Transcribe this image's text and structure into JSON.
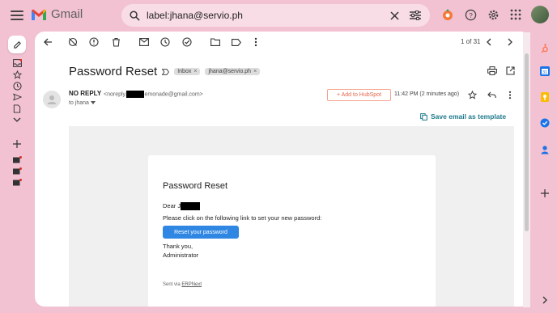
{
  "app": {
    "name": "Gmail"
  },
  "search": {
    "query": "label:jhana@servio.ph"
  },
  "pager": {
    "text": "1 of 31"
  },
  "email": {
    "subject": "Password Reset",
    "labels": [
      "Inbox",
      "jhana@servio.ph"
    ],
    "sender_name": "NO REPLY",
    "sender_email_prefix": "<noreply.",
    "sender_email_suffix": "emonade@gmail.com>",
    "to": "to jhana",
    "hubspot_button": "+ Add to HubSpot",
    "time": "11:42 PM (2 minutes ago)",
    "save_template": "Save email as template"
  },
  "card": {
    "title": "Password Reset",
    "greeting": "Dear J",
    "instruction": "Please click on the following link to set your new password:",
    "button": "Reset your password",
    "closing": "Thank you,",
    "signature": "Administrator",
    "sent_via_prefix": "Sent via",
    "sent_via_link": "ERPNext"
  },
  "colors": {
    "page_bg": "#f2c2d2",
    "accent_button": "#2f86e3",
    "template_link": "#1f7a8c",
    "hubspot": "#e8664a"
  }
}
